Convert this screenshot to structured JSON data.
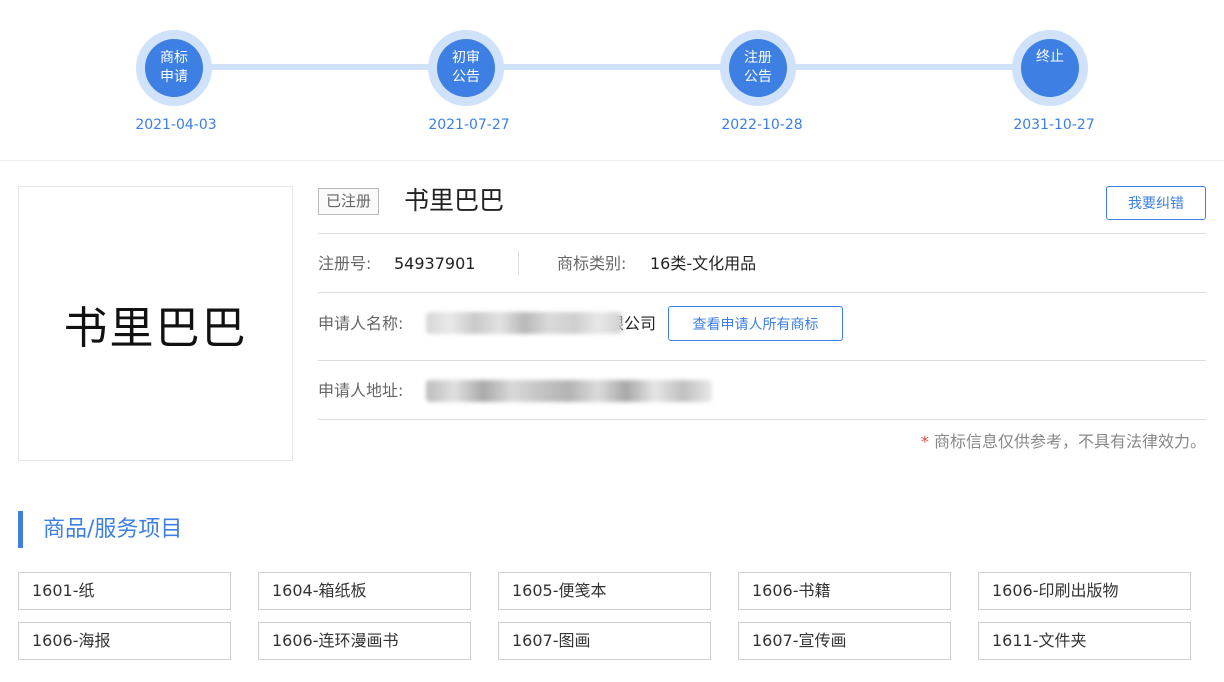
{
  "timeline": [
    {
      "line1": "商标",
      "line2": "申请",
      "date": "2021-04-03"
    },
    {
      "line1": "初审",
      "line2": "公告",
      "date": "2021-07-27"
    },
    {
      "line1": "注册",
      "line2": "公告",
      "date": "2022-10-28"
    },
    {
      "line1": "终止",
      "line2": "",
      "date": "2031-10-27"
    }
  ],
  "logo_text": "书里巴巴",
  "status": "已注册",
  "trademark_name": "书里巴巴",
  "correct_button": "我要纠错",
  "reg_number": {
    "label": "注册号:",
    "value": "54937901"
  },
  "category": {
    "label": "商标类别:",
    "value": "16类-文化用品"
  },
  "applicant": {
    "label": "申请人名称:",
    "visible_suffix": "有限公司",
    "button": "查看申请人所有商标"
  },
  "address": {
    "label": "申请人地址:"
  },
  "disclaimer": {
    "star": "*",
    "text": "商标信息仅供参考，不具有法律效力。"
  },
  "goods_section_title": "商品/服务项目",
  "goods": [
    "1601-纸",
    "1604-箱纸板",
    "1605-便笺本",
    "1606-书籍",
    "1606-印刷出版物",
    "1606-海报",
    "1606-连环漫画书",
    "1607-图画",
    "1607-宣传画",
    "1611-文件夹"
  ],
  "colors": {
    "accent": "#3d7fe2",
    "accent_light": "#cfe2fa",
    "asterisk": "#e94b3c"
  }
}
